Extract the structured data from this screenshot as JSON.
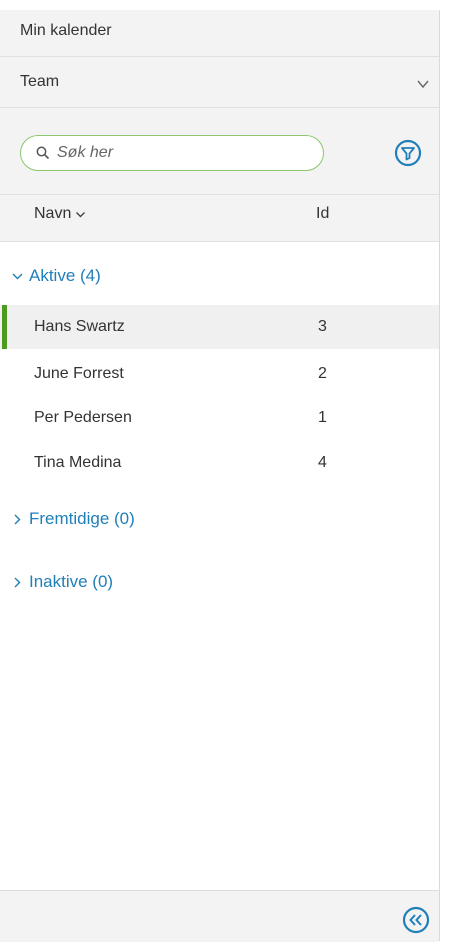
{
  "header": {
    "calendar_label": "Min kalender",
    "team_label": "Team"
  },
  "search": {
    "placeholder": "Søk her",
    "value": ""
  },
  "columns": {
    "name_label": "Navn",
    "id_label": "Id"
  },
  "groups": [
    {
      "label": "Aktive (4)",
      "expanded": true,
      "people": [
        {
          "name": "Hans Swartz",
          "id": "3",
          "selected": true
        },
        {
          "name": "June Forrest",
          "id": "2",
          "selected": false
        },
        {
          "name": "Per Pedersen",
          "id": "1",
          "selected": false
        },
        {
          "name": "Tina Medina",
          "id": "4",
          "selected": false
        }
      ]
    },
    {
      "label": "Fremtidige (0)",
      "expanded": false,
      "people": []
    },
    {
      "label": "Inaktive (0)",
      "expanded": false,
      "people": []
    }
  ],
  "icons": {
    "team_dropdown": "chevron-down-icon",
    "search": "search-icon",
    "filter": "filter-icon",
    "sort": "chevron-down-icon",
    "collapse": "double-chevron-left-icon"
  },
  "colors": {
    "accent_blue": "#1f7fb8",
    "search_border_green": "#8cc66d",
    "selected_marker_green": "#4c9b1e",
    "panel_grey": "#f3f3f3"
  }
}
